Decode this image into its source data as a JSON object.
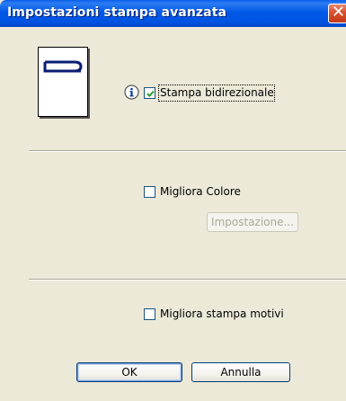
{
  "window": {
    "title": "Impostazioni stampa avanzata",
    "close_symbol": "✕"
  },
  "section_print": {
    "paper_icon": "paper-orientation-icon",
    "info_icon": "info-icon",
    "bidirectional": {
      "label": "Stampa bidirezionale",
      "checked": true
    }
  },
  "section_color": {
    "improve_color": {
      "label": "Migliora Colore",
      "checked": false
    },
    "settings_button": {
      "label": "Impostazione...",
      "enabled": false
    }
  },
  "section_pattern": {
    "improve_pattern": {
      "label": "Migliora stampa motivi",
      "checked": false
    }
  },
  "buttons": {
    "ok": "OK",
    "cancel": "Annulla"
  },
  "colors": {
    "titlebar": "#0054E3",
    "dialog_bg": "#ECE9D8",
    "checkbox_border": "#1C5180",
    "checkmark": "#21A121"
  }
}
